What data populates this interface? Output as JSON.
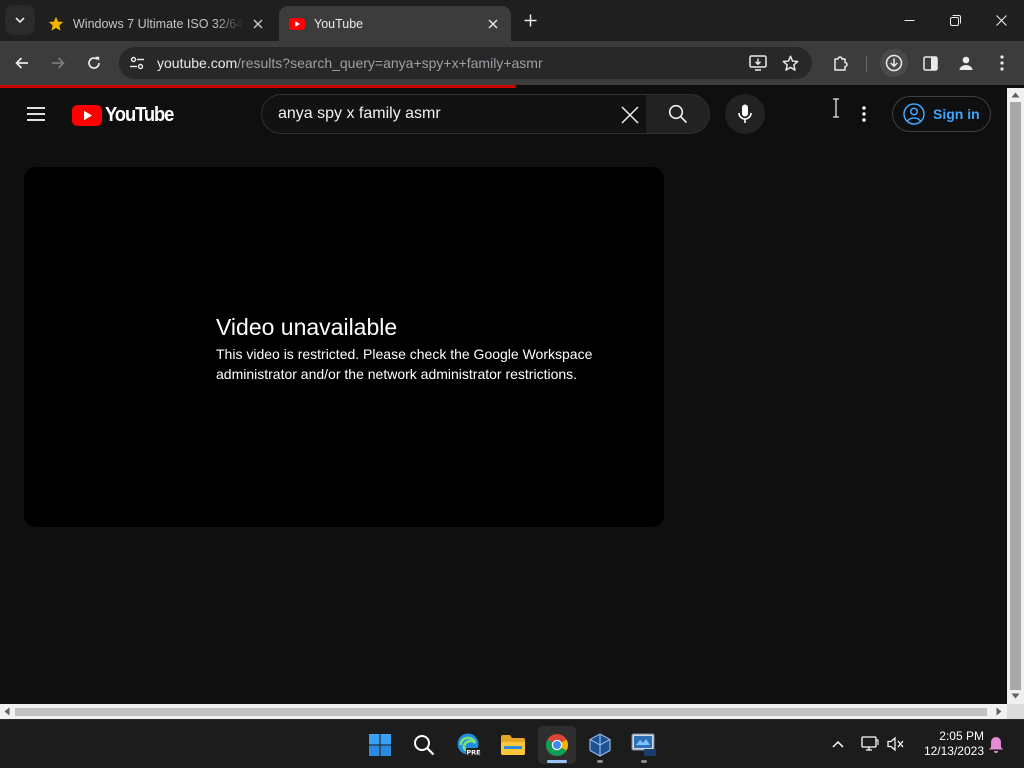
{
  "browser": {
    "tabs": [
      {
        "title": "Windows 7 Ultimate ISO 32/64",
        "favicon": "star-icon",
        "active": false
      },
      {
        "title": "YouTube",
        "favicon": "youtube-icon",
        "active": true
      }
    ],
    "url_host": "youtube.com",
    "url_path": "/results?search_query=anya+spy+x+family+asmr"
  },
  "youtube": {
    "logo_text": "YouTube",
    "search_value": "anya spy x family asmr",
    "sign_in_label": "Sign in",
    "error_title": "Video unavailable",
    "error_message": "This video is restricted. Please check the Google Workspace administrator and/or the network administrator restrictions."
  },
  "taskbar": {
    "time": "2:05 PM",
    "date": "12/13/2023",
    "apps": [
      "start-icon",
      "search-icon",
      "edge-dev-icon",
      "file-explorer-icon",
      "chrome-icon",
      "virtualbox-icon",
      "vista-app-icon"
    ]
  },
  "colors": {
    "youtube_red": "#ff0000",
    "loading_bar": "#cc0000",
    "sign_in_blue": "#3ea6ff"
  }
}
